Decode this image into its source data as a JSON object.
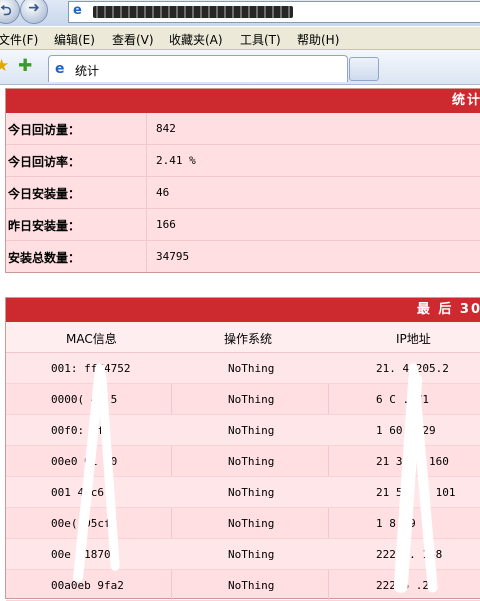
{
  "window": {
    "address_icon": "ie-page-icon"
  },
  "menu": [
    {
      "label": "文件(F)"
    },
    {
      "label": "编辑(E)"
    },
    {
      "label": "查看(V)"
    },
    {
      "label": "收藏夹(A)"
    },
    {
      "label": "工具(T)"
    },
    {
      "label": "帮助(H)"
    }
  ],
  "tab": {
    "label": "统计"
  },
  "stats": {
    "header": "统计",
    "rows": [
      {
        "label": "今日回访量：",
        "value": "842"
      },
      {
        "label": "今日回访率：",
        "value": "2.41 %"
      },
      {
        "label": "今日安装量：",
        "value": "46"
      },
      {
        "label": "昨日安装量：",
        "value": "166"
      },
      {
        "label": "安装总数量：",
        "value": "34795"
      }
    ]
  },
  "recent": {
    "header": "最 后 30",
    "columns": [
      "MAC信息",
      "操作系统",
      "IP地址"
    ],
    "rows": [
      {
        "mac": "001:   ff74752",
        "os": "NoThing",
        "ip": "21.   4 205.2"
      },
      {
        "mac": "0000(  4b 5",
        "os": "NoThing",
        "ip": "6   C   .171"
      },
      {
        "mac": "00f0:   dff",
        "os": "NoThing",
        "ip": "1   60.   .29"
      },
      {
        "mac": "00e0   01 70",
        "os": "NoThing",
        "ip": "21   39.   .160"
      },
      {
        "mac": "001   48c6",
        "os": "NoThing",
        "ip": "21   54.   2 101"
      },
      {
        "mac": "00e(   05cff",
        "os": "NoThing",
        "ip": "1   8   39"
      },
      {
        "mac": "00e   41870",
        "os": "NoThing",
        "ip": "222   7.   158"
      },
      {
        "mac": "00a0eb   9fa2",
        "os": "NoThing",
        "ip": "222.6   .22"
      }
    ]
  },
  "colors": {
    "header_red": "#cc2a2f",
    "panel_pink": "#ffdfe2"
  }
}
